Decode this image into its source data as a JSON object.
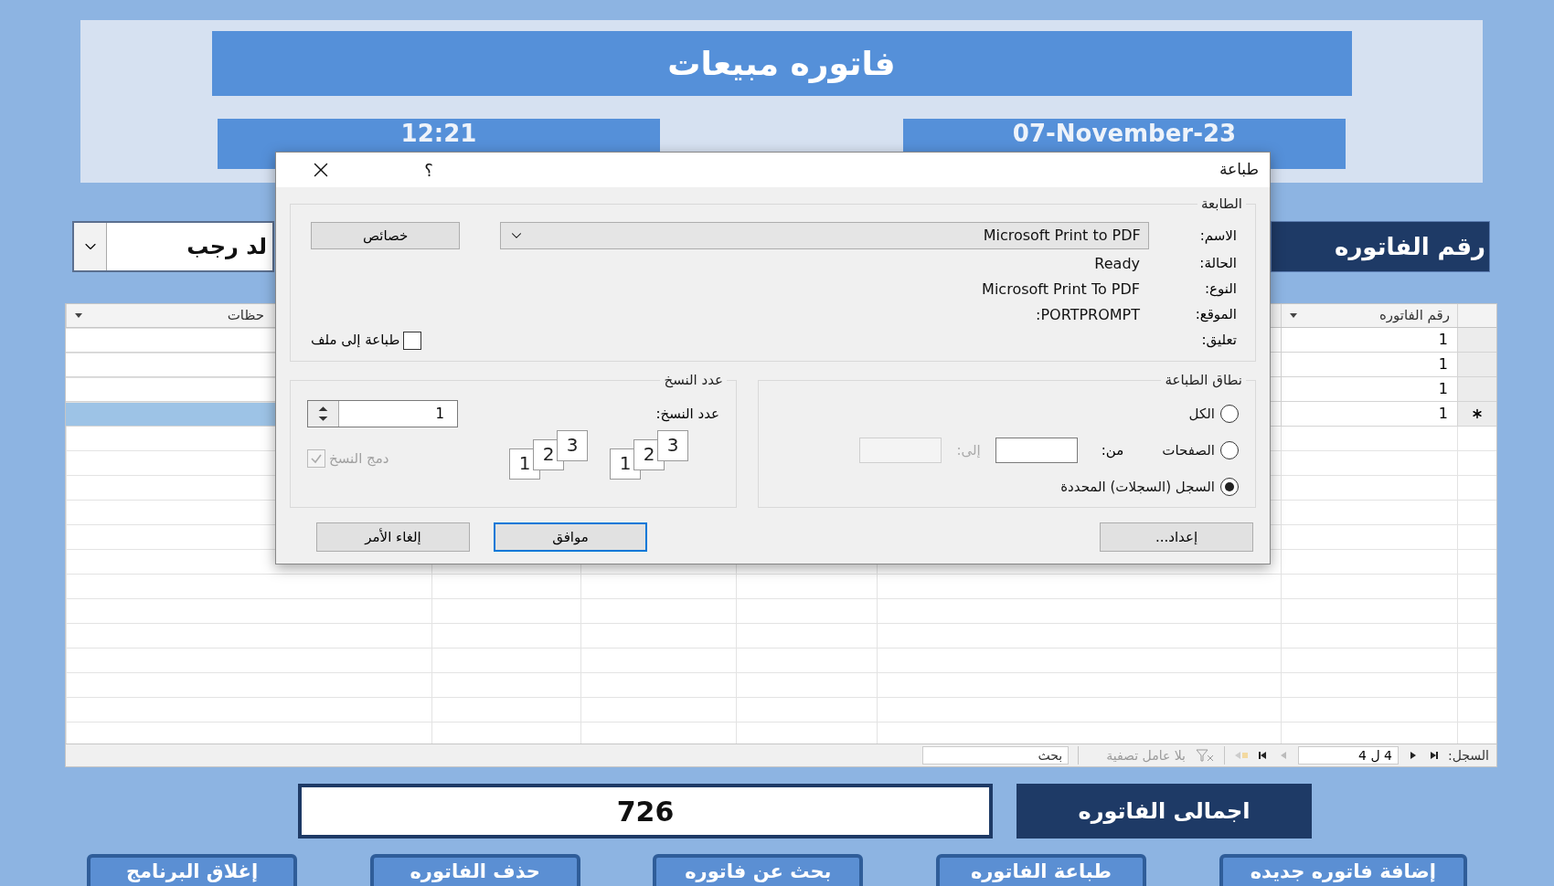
{
  "header": {
    "title": "فاتوره مبيعات",
    "time": "12:21",
    "date": "07-November-23"
  },
  "invoice_selector": {
    "label": "رقم الفاتوره",
    "value": "لد رجب"
  },
  "table": {
    "columns": [
      {
        "label": "رقم الفاتوره"
      },
      {
        "label": "حظات"
      }
    ],
    "rows": [
      {
        "kind": "record",
        "selected": false,
        "cells": [
          "1"
        ]
      },
      {
        "kind": "record",
        "selected": false,
        "cells": [
          "1"
        ]
      },
      {
        "kind": "record",
        "selected": false,
        "cells": [
          "1"
        ]
      },
      {
        "kind": "new",
        "selected": true,
        "cells": [
          "1"
        ]
      }
    ]
  },
  "record_nav": {
    "label": "السجل:",
    "position": "4 ل 4",
    "filter": "بلا عامل تصفية",
    "search_placeholder": "بحث"
  },
  "total": {
    "label": "اجمالى الفاتوره",
    "value": "726"
  },
  "buttons": [
    "إضافة فاتوره جديده",
    "طباعة الفاتوره",
    "بحث عن فاتوره",
    "حذف الفاتوره",
    "إغلاق البرنامج"
  ],
  "print_dialog": {
    "title": "طباعة",
    "help": "؟",
    "printer": {
      "legend": "الطابعة",
      "name_label": "الاسم:",
      "name": "Microsoft Print to PDF",
      "properties_button": "خصائص",
      "info": [
        {
          "label": "الحالة:",
          "value": "Ready"
        },
        {
          "label": "النوع:",
          "value": "Microsoft Print To PDF"
        },
        {
          "label": "الموقع:",
          "value": "PORTPROMPT:"
        },
        {
          "label": "تعليق:"
        }
      ],
      "print_to_file": {
        "label": "طباعة إلى ملف",
        "checked": false
      }
    },
    "range": {
      "legend": "نطاق الطباعة",
      "from_label": "من:",
      "to_label": "إلى:",
      "options": [
        {
          "kind": "all",
          "label": "الكل",
          "selected": false
        },
        {
          "kind": "pages",
          "label": "الصفحات",
          "selected": false
        },
        {
          "kind": "selection",
          "label": "السجل (السجلات) المحددة",
          "selected": true
        }
      ]
    },
    "copies": {
      "legend": "عدد النسخ",
      "count_label": "عدد النسخ:",
      "count": "1",
      "collate": {
        "label": "دمج النسخ",
        "checked": true,
        "disabled": true
      },
      "stacks": [
        [
          "1",
          "2",
          "3"
        ],
        [
          "1",
          "2",
          "3"
        ]
      ]
    },
    "buttons": [
      {
        "label": "إعداد...",
        "default": false
      },
      {
        "label": "موافق",
        "default": true
      },
      {
        "label": "إلغاء الأمر",
        "default": false
      }
    ]
  }
}
